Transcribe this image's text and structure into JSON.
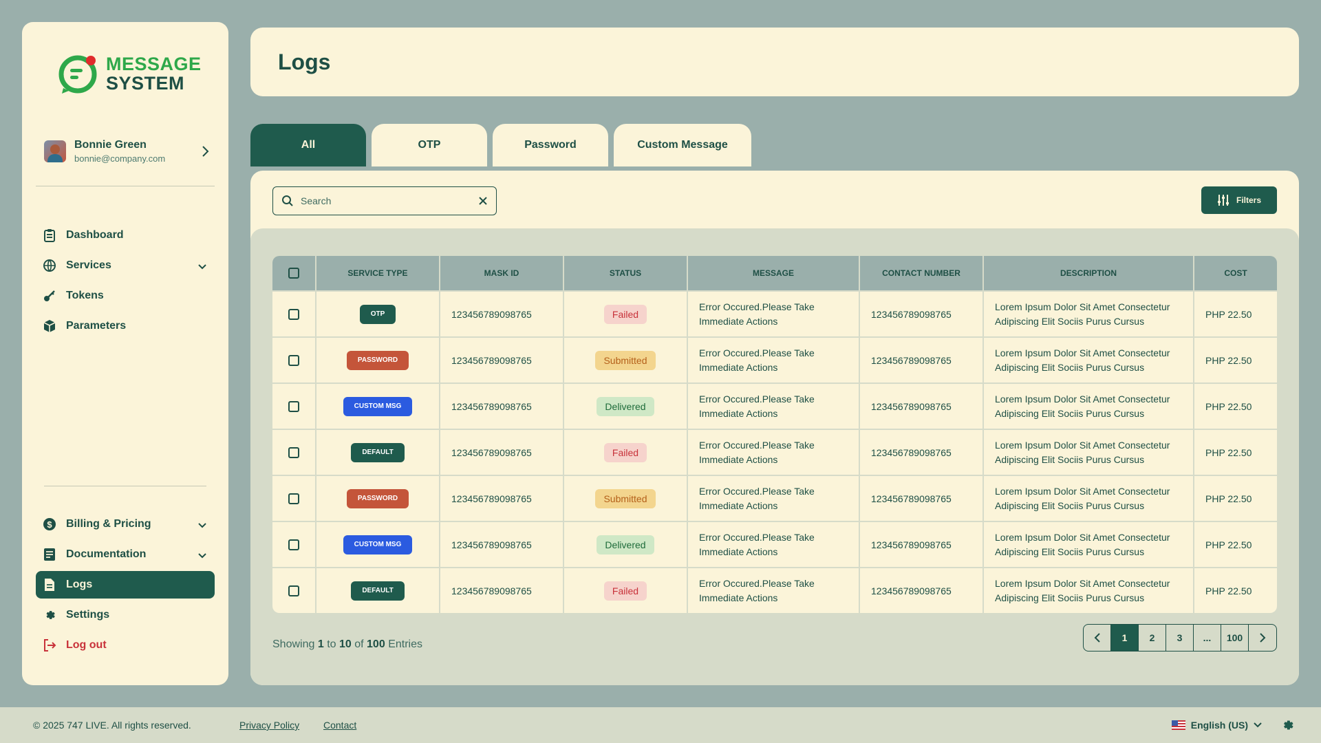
{
  "colors": {
    "background": "#9aafab",
    "surface": "#fbf4d9",
    "primary": "#1f5b4d",
    "brand_green": "#2ea84a",
    "danger": "#c8323a"
  },
  "brand": {
    "line1": "MESSAGE",
    "line2": "SYSTEM",
    "icon": "message-logo-icon"
  },
  "profile": {
    "name": "Bonnie Green",
    "email": "bonnie@company.com"
  },
  "nav_main": [
    {
      "label": "Dashboard",
      "icon": "clipboard-icon",
      "expandable": false
    },
    {
      "label": "Services",
      "icon": "globe-icon",
      "expandable": true
    },
    {
      "label": "Tokens",
      "icon": "key-icon",
      "expandable": false
    },
    {
      "label": "Parameters",
      "icon": "cube-icon",
      "expandable": false
    }
  ],
  "nav_bottom": [
    {
      "label": "Billing & Pricing",
      "icon": "dollar-icon",
      "expandable": true
    },
    {
      "label": "Documentation",
      "icon": "document-icon",
      "expandable": true
    },
    {
      "label": "Logs",
      "icon": "file-text-icon",
      "expandable": false,
      "active": true
    },
    {
      "label": "Settings",
      "icon": "gear-icon",
      "expandable": false
    },
    {
      "label": "Log out",
      "icon": "logout-icon",
      "expandable": false
    }
  ],
  "header": {
    "title": "Logs"
  },
  "tabs": [
    {
      "label": "All",
      "active": true
    },
    {
      "label": "OTP"
    },
    {
      "label": "Password"
    },
    {
      "label": "Custom Message"
    }
  ],
  "search": {
    "placeholder": "Search",
    "value": ""
  },
  "filters_label": "Filters",
  "table": {
    "columns": [
      "SERVICE TYPE",
      "MASK ID",
      "STATUS",
      "MESSAGE",
      "CONTACT NUMBER",
      "DESCRIPTION",
      "COST"
    ],
    "rows": [
      {
        "service": "OTP",
        "mask_id": "123456789098765",
        "status": "Failed",
        "message": "Error Occured.Please Take Immediate Actions",
        "contact": "123456789098765",
        "description": "Lorem Ipsum Dolor Sit Amet Consectetur Adipiscing Elit Sociis Purus Cursus",
        "cost": "PHP 22.50"
      },
      {
        "service": "PASSWORD",
        "mask_id": "123456789098765",
        "status": "Submitted",
        "message": "Error Occured.Please Take Immediate Actions",
        "contact": "123456789098765",
        "description": "Lorem Ipsum Dolor Sit Amet Consectetur Adipiscing Elit Sociis Purus Cursus",
        "cost": "PHP 22.50"
      },
      {
        "service": "CUSTOM MSG",
        "mask_id": "123456789098765",
        "status": "Delivered",
        "message": "Error Occured.Please Take Immediate Actions",
        "contact": "123456789098765",
        "description": "Lorem Ipsum Dolor Sit Amet Consectetur Adipiscing Elit Sociis Purus Cursus",
        "cost": "PHP 22.50"
      },
      {
        "service": "DEFAULT",
        "mask_id": "123456789098765",
        "status": "Failed",
        "message": "Error Occured.Please Take Immediate Actions",
        "contact": "123456789098765",
        "description": "Lorem Ipsum Dolor Sit Amet Consectetur Adipiscing Elit Sociis Purus Cursus",
        "cost": "PHP 22.50"
      },
      {
        "service": "PASSWORD",
        "mask_id": "123456789098765",
        "status": "Submitted",
        "message": "Error Occured.Please Take Immediate Actions",
        "contact": "123456789098765",
        "description": "Lorem Ipsum Dolor Sit Amet Consectetur Adipiscing Elit Sociis Purus Cursus",
        "cost": "PHP 22.50"
      },
      {
        "service": "CUSTOM MSG",
        "mask_id": "123456789098765",
        "status": "Delivered",
        "message": "Error Occured.Please Take Immediate Actions",
        "contact": "123456789098765",
        "description": "Lorem Ipsum Dolor Sit Amet Consectetur Adipiscing Elit Sociis Purus Cursus",
        "cost": "PHP 22.50"
      },
      {
        "service": "DEFAULT",
        "mask_id": "123456789098765",
        "status": "Failed",
        "message": "Error Occured.Please Take Immediate Actions",
        "contact": "123456789098765",
        "description": "Lorem Ipsum Dolor Sit Amet Consectetur Adipiscing Elit Sociis Purus Cursus",
        "cost": "PHP 22.50"
      }
    ]
  },
  "service_colors": {
    "OTP": "#1f5b4d",
    "PASSWORD": "#c4553a",
    "CUSTOM MSG": "#2b5be0",
    "DEFAULT": "#1f5b4d"
  },
  "status_styles": {
    "Failed": {
      "bg": "#f6d3cc",
      "fg": "#c8323a"
    },
    "Submitted": {
      "bg": "#f3d58e",
      "fg": "#b4601a"
    },
    "Delivered": {
      "bg": "#cfe8c6",
      "fg": "#1e6b3a"
    }
  },
  "showing": {
    "prefix": "Showing",
    "from": "1",
    "to_word": "to",
    "to": "10",
    "of_word": "of",
    "total": "100",
    "suffix": "Entries"
  },
  "pagination": {
    "pages": [
      "1",
      "2",
      "3",
      "...",
      "100"
    ],
    "current": "1"
  },
  "footer": {
    "copyright": "© 2025 747 LIVE. All rights reserved.",
    "privacy": "Privacy Policy",
    "contact": "Contact",
    "language": "English (US)"
  }
}
